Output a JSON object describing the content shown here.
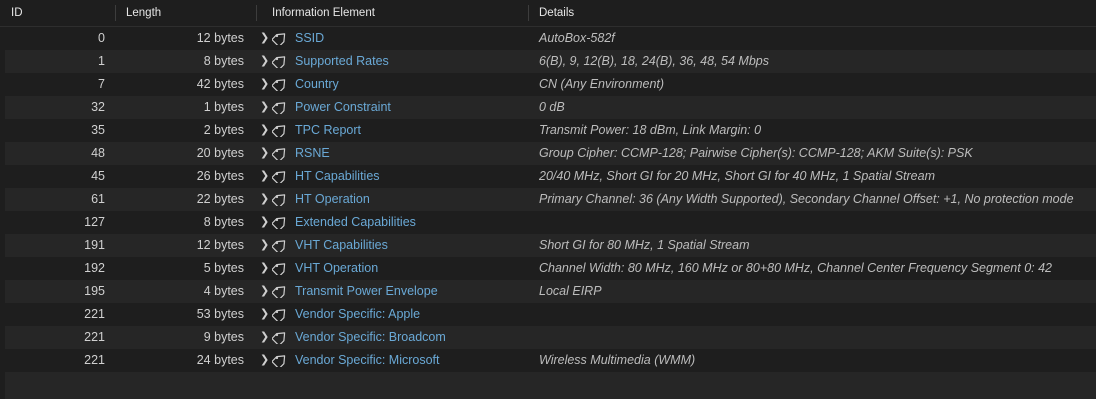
{
  "headers": {
    "id": "ID",
    "length": "Length",
    "info": "Information Element",
    "details": "Details"
  },
  "rows": [
    {
      "id": "0",
      "length": "12 bytes",
      "name": "SSID",
      "details": "AutoBox-582f"
    },
    {
      "id": "1",
      "length": "8 bytes",
      "name": "Supported Rates",
      "details": "6(B), 9, 12(B), 18, 24(B), 36, 48, 54 Mbps"
    },
    {
      "id": "7",
      "length": "42 bytes",
      "name": "Country",
      "details": "CN (Any Environment)"
    },
    {
      "id": "32",
      "length": "1 bytes",
      "name": "Power Constraint",
      "details": "0 dB"
    },
    {
      "id": "35",
      "length": "2 bytes",
      "name": "TPC Report",
      "details": "Transmit Power: 18 dBm, Link Margin: 0"
    },
    {
      "id": "48",
      "length": "20 bytes",
      "name": "RSNE",
      "details": "Group Cipher: CCMP-128; Pairwise Cipher(s): CCMP-128; AKM Suite(s): PSK"
    },
    {
      "id": "45",
      "length": "26 bytes",
      "name": "HT Capabilities",
      "details": "20/40 MHz, Short GI for 20 MHz, Short GI for 40 MHz, 1 Spatial Stream"
    },
    {
      "id": "61",
      "length": "22 bytes",
      "name": "HT Operation",
      "details": "Primary Channel: 36 (Any Width Supported), Secondary Channel Offset: +1, No protection mode"
    },
    {
      "id": "127",
      "length": "8 bytes",
      "name": "Extended Capabilities",
      "details": ""
    },
    {
      "id": "191",
      "length": "12 bytes",
      "name": "VHT Capabilities",
      "details": "Short GI for 80 MHz, 1 Spatial Stream"
    },
    {
      "id": "192",
      "length": "5 bytes",
      "name": "VHT Operation",
      "details": "Channel Width: 80 MHz, 160 MHz or 80+80 MHz, Channel Center Frequency Segment 0: 42"
    },
    {
      "id": "195",
      "length": "4 bytes",
      "name": "Transmit Power Envelope",
      "details": "Local EIRP"
    },
    {
      "id": "221",
      "length": "53 bytes",
      "name": "Vendor Specific: Apple",
      "details": ""
    },
    {
      "id": "221",
      "length": "9 bytes",
      "name": "Vendor Specific: Broadcom",
      "details": ""
    },
    {
      "id": "221",
      "length": "24 bytes",
      "name": "Vendor Specific: Microsoft",
      "details": "Wireless Multimedia (WMM)"
    }
  ],
  "icons": {
    "expand": "chevron-right-icon",
    "element": "tag-icon"
  },
  "colors": {
    "background": "#1e1e1e",
    "row_alt": "#262626",
    "element_name": "#6aa9d6",
    "details_text": "#bdbdbd"
  }
}
